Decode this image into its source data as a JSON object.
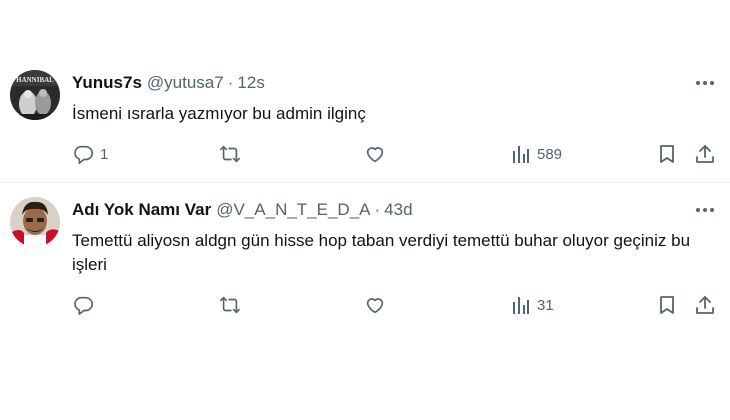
{
  "tweets": [
    {
      "display_name": "Yunus7s",
      "handle": "@yutusa7",
      "separator": "·",
      "time": "12s",
      "text": "İsmeni ısrarla yazmıyor bu admin ilginç",
      "avatar_caption": "HANNIBAL",
      "reply_count": "1",
      "retweet_count": "",
      "like_count": "",
      "view_count": "589"
    },
    {
      "display_name": "Adı Yok Namı Var",
      "handle": "@V_A_N_T_E_D_A",
      "separator": "·",
      "time": "43d",
      "text": "Temettü aliyosn aldgn gün hisse hop taban verdiyi temettü buhar oluyor geçiniz bu işleri",
      "reply_count": "",
      "retweet_count": "",
      "like_count": "",
      "view_count": "31"
    }
  ],
  "icons": {
    "reply": "reply-icon",
    "retweet": "retweet-icon",
    "like": "heart-icon",
    "views": "views-icon",
    "bookmark": "bookmark-icon",
    "share": "share-icon",
    "more": "more-icon"
  },
  "colors": {
    "text_primary": "#0f1419",
    "text_secondary": "#536471",
    "divider": "#eff3f4"
  }
}
